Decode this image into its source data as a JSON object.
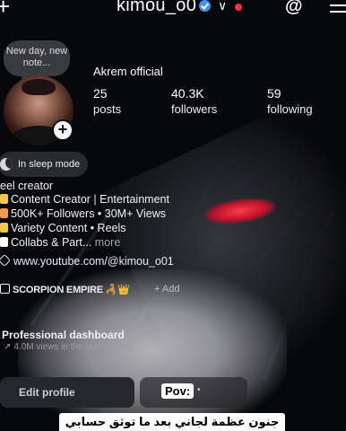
{
  "header": {
    "username": "kimou_o0",
    "new_icon": "+",
    "chevron": "∨",
    "threads_icon": "@"
  },
  "note": {
    "text": "New day, new note..."
  },
  "profile": {
    "display_name": "Akrem official",
    "stats": [
      {
        "value": "25",
        "label": "posts"
      },
      {
        "value": "40.3K",
        "label": "followers"
      },
      {
        "value": "59",
        "label": "following"
      }
    ]
  },
  "status": {
    "sleep_label": "In sleep mode"
  },
  "bio": {
    "category": "eel creator",
    "lines": [
      {
        "icon_color": "#f2c94c",
        "text": "Content Creator | Entertainment"
      },
      {
        "icon_color": "#f2994a",
        "text": "500K+ Followers • 30M+ Views"
      },
      {
        "icon_color": "#f2c94c",
        "text": "Variety Content • Reels"
      },
      {
        "icon_color": "#ffffff",
        "text": "Collabs & Part..."
      }
    ],
    "more_label": " more",
    "link": "www.youtube.com/@kimou_o01"
  },
  "community": {
    "name": "SCORPION EMPIRE 🦂👑",
    "add_label": "+ Add"
  },
  "dashboard": {
    "title": "Professional dashboard",
    "subtitle": "4.0M views in the last 30 days"
  },
  "actions": {
    "edit_label": "Edit profile"
  },
  "caption": {
    "pov": "Pov:",
    "dot": "•",
    "arabic": "جنون عظمة لجاني بعد ما توثق حسابي"
  },
  "colors": {
    "verified": "#3b97f0",
    "notification": "#ff3040",
    "accent_red": "#ff3b4c"
  }
}
